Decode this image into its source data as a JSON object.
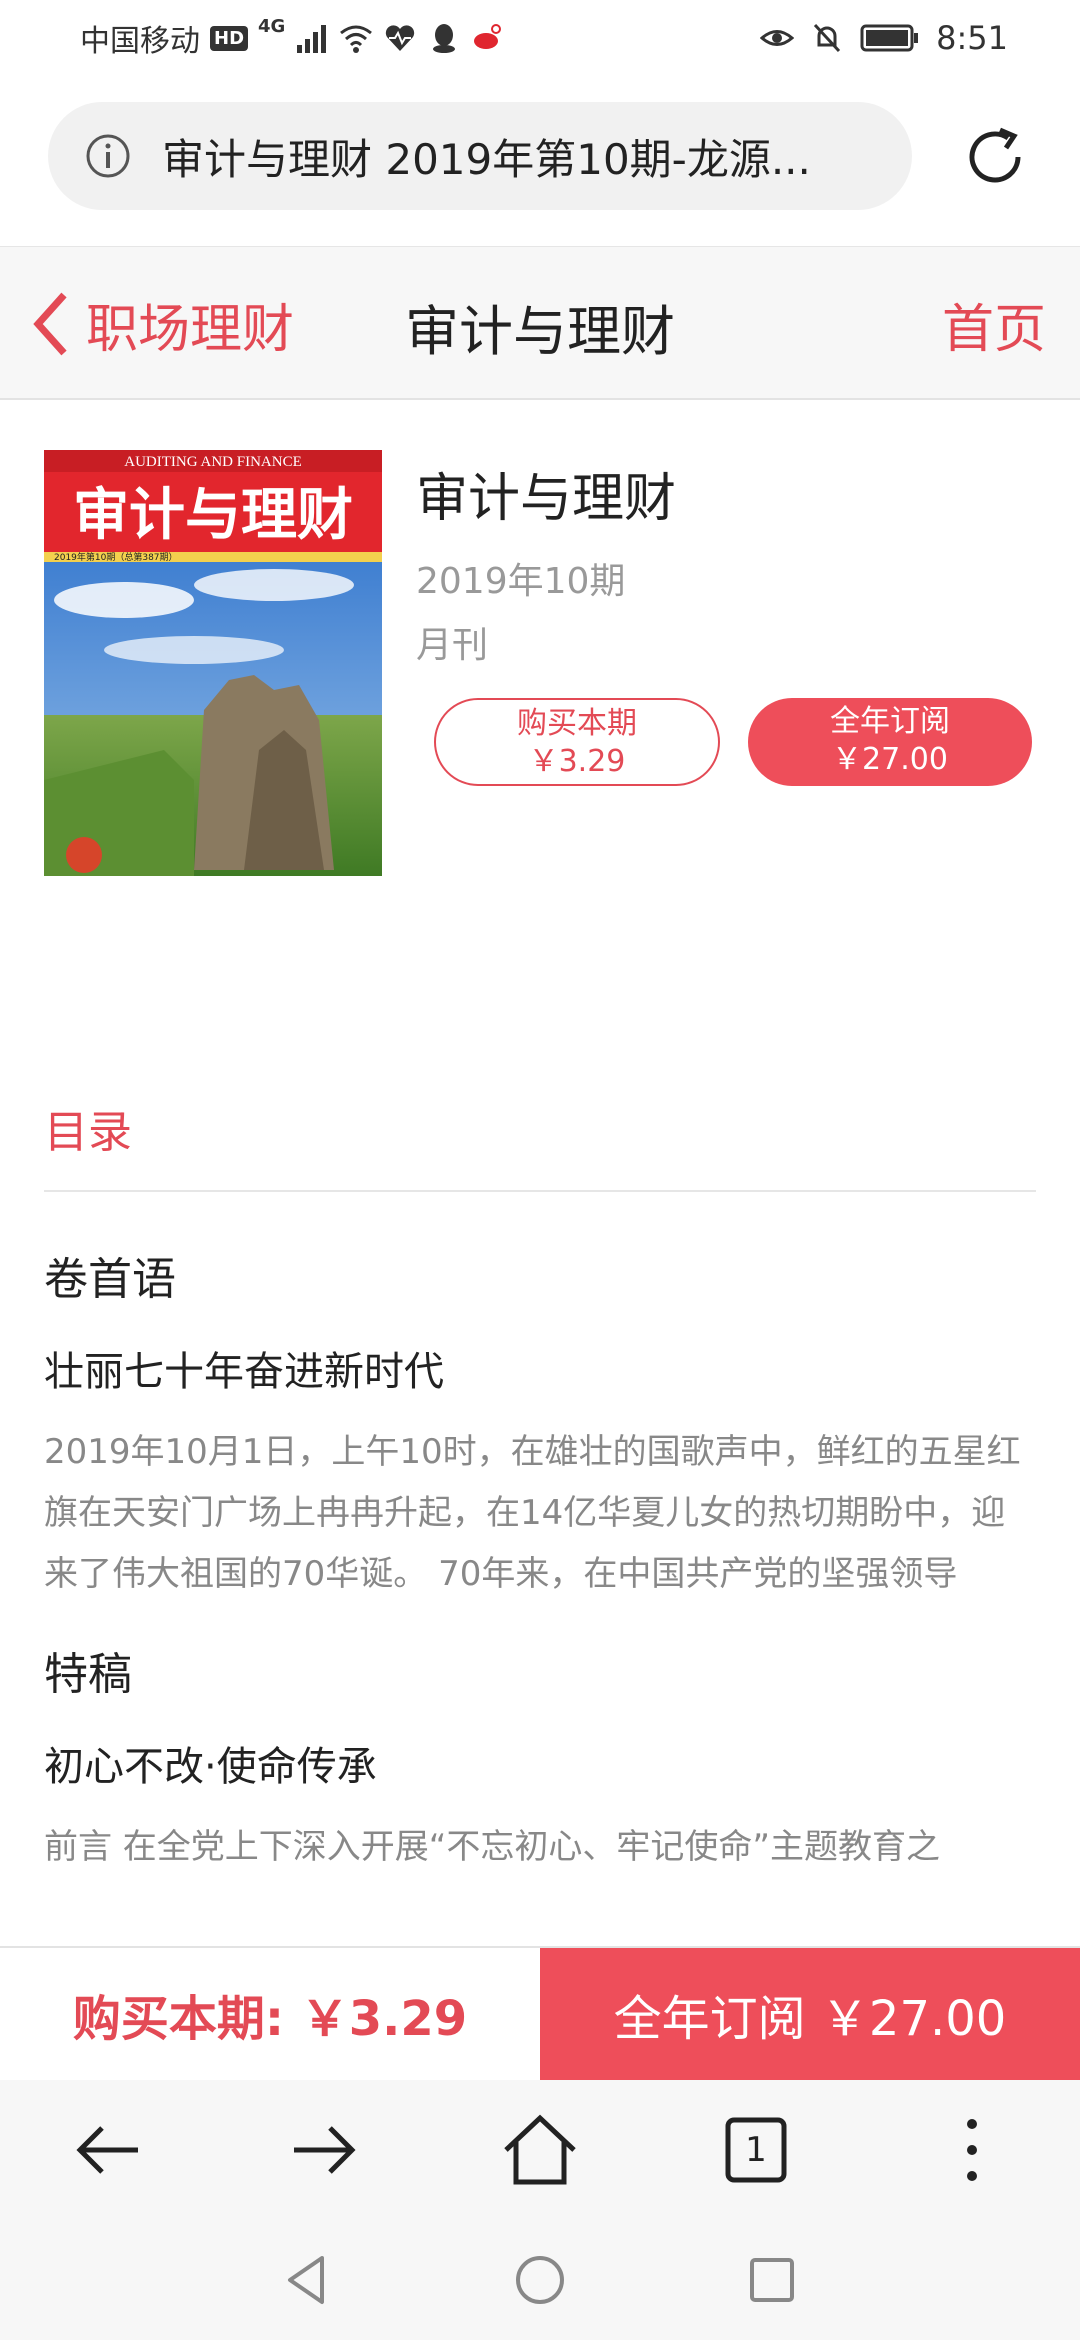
{
  "status_bar": {
    "carrier": "中国移动",
    "hd_badge": "HD",
    "network": "4G",
    "time": "8:51",
    "icons": [
      "signal-icon",
      "wifi-icon",
      "heartbeat-icon",
      "qq-icon",
      "weibo-icon",
      "eye-icon",
      "mute-bell-icon",
      "battery-icon"
    ]
  },
  "url_bar": {
    "text": "审计与理财 2019年第10期-龙源..."
  },
  "header": {
    "back_label": "职场理财",
    "title": "审计与理财",
    "home_label": "首页"
  },
  "magazine": {
    "title": "审计与理财",
    "issue": "2019年10期",
    "frequency": "月刊",
    "cover": {
      "masthead_en": "AUDITING AND FINANCE",
      "masthead_cn": "审计与理财",
      "issue_line": "2019年第10期（总第387期）"
    },
    "buy_button": {
      "label": "购买本期",
      "price": "￥3.29"
    },
    "subscribe_button": {
      "label": "全年订阅",
      "price": "￥27.00"
    }
  },
  "toc": {
    "heading": "目录",
    "sections": [
      {
        "name": "卷首语",
        "articles": [
          {
            "title": "壮丽七十年奋进新时代",
            "summary": "2019年10月1日，上午10时，在雄壮的国歌声中，鲜红的五星红旗在天安门广场上冉冉升起，在14亿华夏儿女的热切期盼中，迎来了伟大祖国的70华诞。 70年来，在中国共产党的坚强领导"
          }
        ]
      },
      {
        "name": "特稿",
        "articles": [
          {
            "title": "初心不改·使命传承",
            "summary": "前言 在全党上下深入开展“不忘初心、牢记使命”主题教育之"
          }
        ]
      }
    ]
  },
  "purchase_bar": {
    "buy_label": "购买本期: ￥3.29",
    "subscribe_label": "全年订阅 ￥27.00"
  },
  "browser_nav": {
    "tab_count": "1",
    "icons": [
      "back-arrow-icon",
      "forward-arrow-icon",
      "home-icon",
      "tabs-icon",
      "more-vertical-icon"
    ]
  },
  "android_nav": {
    "icons": [
      "back-triangle-icon",
      "home-circle-icon",
      "recents-square-icon"
    ]
  },
  "colors": {
    "accent": "#e34a55",
    "accent_fill": "#ee4e5a",
    "muted_text": "#999999"
  }
}
